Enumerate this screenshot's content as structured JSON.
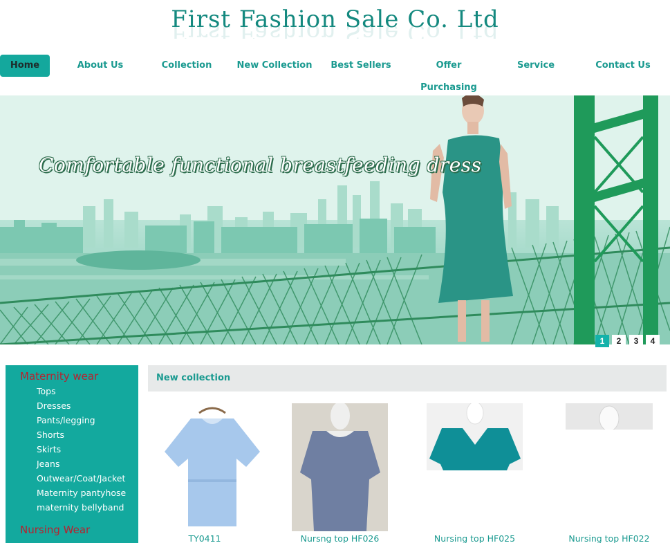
{
  "header": {
    "title": "First Fashion Sale Co. Ltd"
  },
  "nav": {
    "items": [
      {
        "label": "Home",
        "active": true
      },
      {
        "label": "About Us"
      },
      {
        "label": "Collection"
      },
      {
        "label": "New Collection"
      },
      {
        "label": "Best Sellers"
      },
      {
        "label": "Offer Purchasing"
      },
      {
        "label": "Service"
      },
      {
        "label": "Contact Us"
      }
    ]
  },
  "banner": {
    "headline": "Comfortable functional breastfeeding dress",
    "pager": [
      "1",
      "2",
      "3",
      "4"
    ],
    "active_page": "1"
  },
  "sidebar": {
    "category1": "Maternity wear",
    "items": [
      "Tops",
      "Dresses",
      "Pants/legging",
      "Shorts",
      "Skirts",
      "Jeans",
      "Outwear/Coat/Jacket",
      "Maternity pantyhose",
      "maternity bellyband"
    ],
    "category2": "Nursing Wear"
  },
  "new_collection": {
    "title": "New collection",
    "products": [
      {
        "name": "TY0411"
      },
      {
        "name": "Nursng top HF026"
      },
      {
        "name": "Nursing top HF025"
      },
      {
        "name": "Nursing top HF022"
      }
    ]
  },
  "colors": {
    "accent": "#14a89d",
    "title": "#14897f",
    "category_red": "#b6222f"
  }
}
